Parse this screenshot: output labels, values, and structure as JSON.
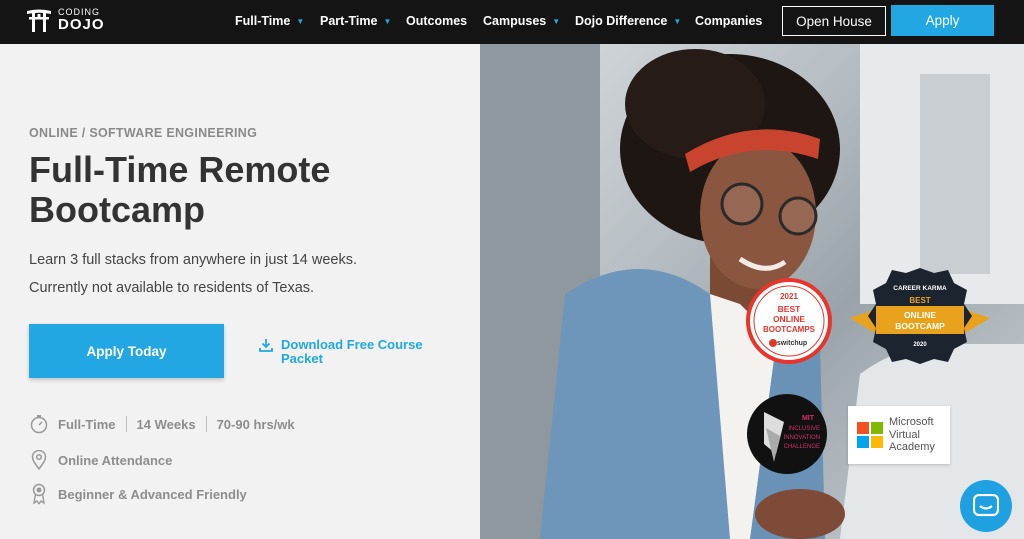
{
  "brand": {
    "line1": "CODING",
    "line2": "DOJO"
  },
  "nav": {
    "items": [
      {
        "label": "Full-Time",
        "caret": true
      },
      {
        "label": "Part-Time",
        "caret": true
      },
      {
        "label": "Outcomes",
        "caret": false
      },
      {
        "label": "Campuses",
        "caret": true
      },
      {
        "label": "Dojo Difference",
        "caret": true
      },
      {
        "label": "Companies",
        "caret": false
      }
    ],
    "open_house": "Open House",
    "apply": "Apply"
  },
  "hero": {
    "eyebrow": "ONLINE / SOFTWARE ENGINEERING",
    "title": "Full-Time Remote Bootcamp",
    "subtitle1": "Learn 3 full stacks from anywhere in just 14 weeks.",
    "subtitle2": "Currently not available to residents of Texas.",
    "apply_today": "Apply Today",
    "download": "Download Free Course Packet",
    "features": {
      "schedule": "Full-Time",
      "weeks": "14 Weeks",
      "hours": "70-90 hrs/wk",
      "attendance": "Online Attendance",
      "level": "Beginner & Advanced Friendly"
    }
  },
  "badges": {
    "switchup": {
      "year": "2021",
      "line1": "BEST",
      "line2": "ONLINE",
      "line3": "BOOTCAMPS",
      "brand": "switchup"
    },
    "career_karma": {
      "brand": "CAREER KARMA",
      "line1": "BEST",
      "line2": "ONLINE",
      "line3": "BOOTCAMP",
      "year": "2020"
    },
    "mit": {
      "line1": "MIT",
      "line2": "INCLUSIVE",
      "line3": "INNOVATION",
      "line4": "CHALLENGE"
    },
    "microsoft": {
      "line1": "Microsoft",
      "line2": "Virtual",
      "line3": "Academy"
    }
  },
  "colors": {
    "accent": "#22a7e2",
    "nav_bg": "#141414"
  }
}
